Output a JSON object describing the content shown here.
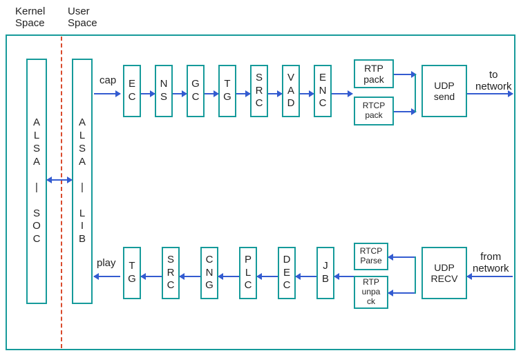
{
  "headers": {
    "kernel": "Kernel\nSpace",
    "user": "User\nSpace"
  },
  "left": {
    "alsa_soc": "ALSA | SOC",
    "alsa_lib": "ALSA | LIB"
  },
  "top_chain": {
    "cap": "cap",
    "ec": "EC",
    "ns": "NS",
    "gc": "GC",
    "tg": "TG",
    "src": "SRC",
    "vad": "VAD",
    "enc": "ENC",
    "rtp_pack": "RTP\npack",
    "rtcp_pack": "RTCP\npack",
    "udp_send": "UDP\nsend",
    "to_net": "to\nnetwork"
  },
  "bot_chain": {
    "play": "play",
    "tg": "TG",
    "src": "SRC",
    "cng": "CNG",
    "plc": "PLC",
    "dec": "DEC",
    "jb": "JB",
    "rtcp_parse": "RTCP\nParse",
    "rtp_unpack": "RTP\nunpa\nck",
    "udp_recv": "UDP\nRECV",
    "from_net": "from\nnetwork"
  }
}
